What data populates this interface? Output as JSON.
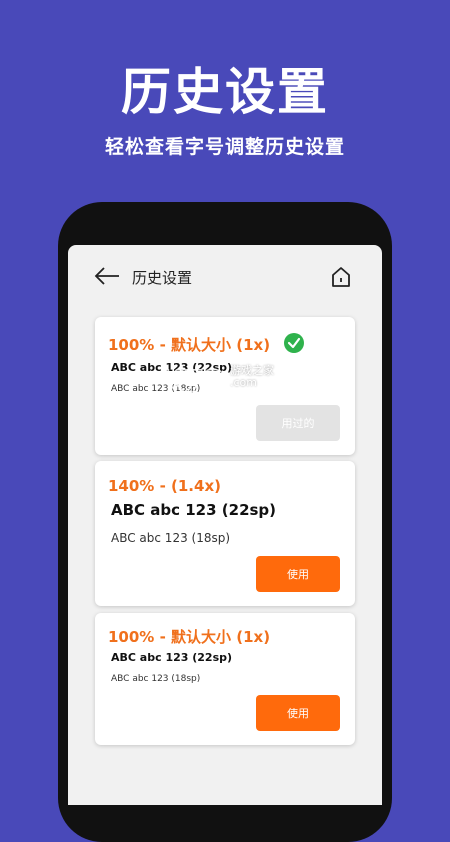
{
  "promo": {
    "title": "历史设置",
    "subtitle": "轻松查看字号调整历史设置"
  },
  "header": {
    "title": "历史设置",
    "back_icon": "arrow-left-icon",
    "home_icon": "home-icon"
  },
  "cards": [
    {
      "heading": "100% - 默认大小 (1x)",
      "large_sample": "ABC abc 123 (22sp)",
      "small_sample": "ABC abc 123 (18sp)",
      "selected": true,
      "button_label": "用过的"
    },
    {
      "heading": "140% - (1.4x)",
      "large_sample": "ABC abc 123 (22sp)",
      "small_sample": "ABC abc 123 (18sp)",
      "selected": false,
      "button_label": "使用"
    },
    {
      "heading": "100% - 默认大小 (1x)",
      "large_sample": "ABC abc 123 (22sp)",
      "small_sample": "ABC abc 123 (18sp)",
      "selected": false,
      "button_label": "使用"
    }
  ],
  "watermark": {
    "logo": "K73",
    "line1": "游戏之家",
    "line2": ".com"
  },
  "colors": {
    "background": "#4949b9",
    "accent": "#f0701c",
    "button": "#ff6a0c",
    "check": "#2fb24c"
  }
}
